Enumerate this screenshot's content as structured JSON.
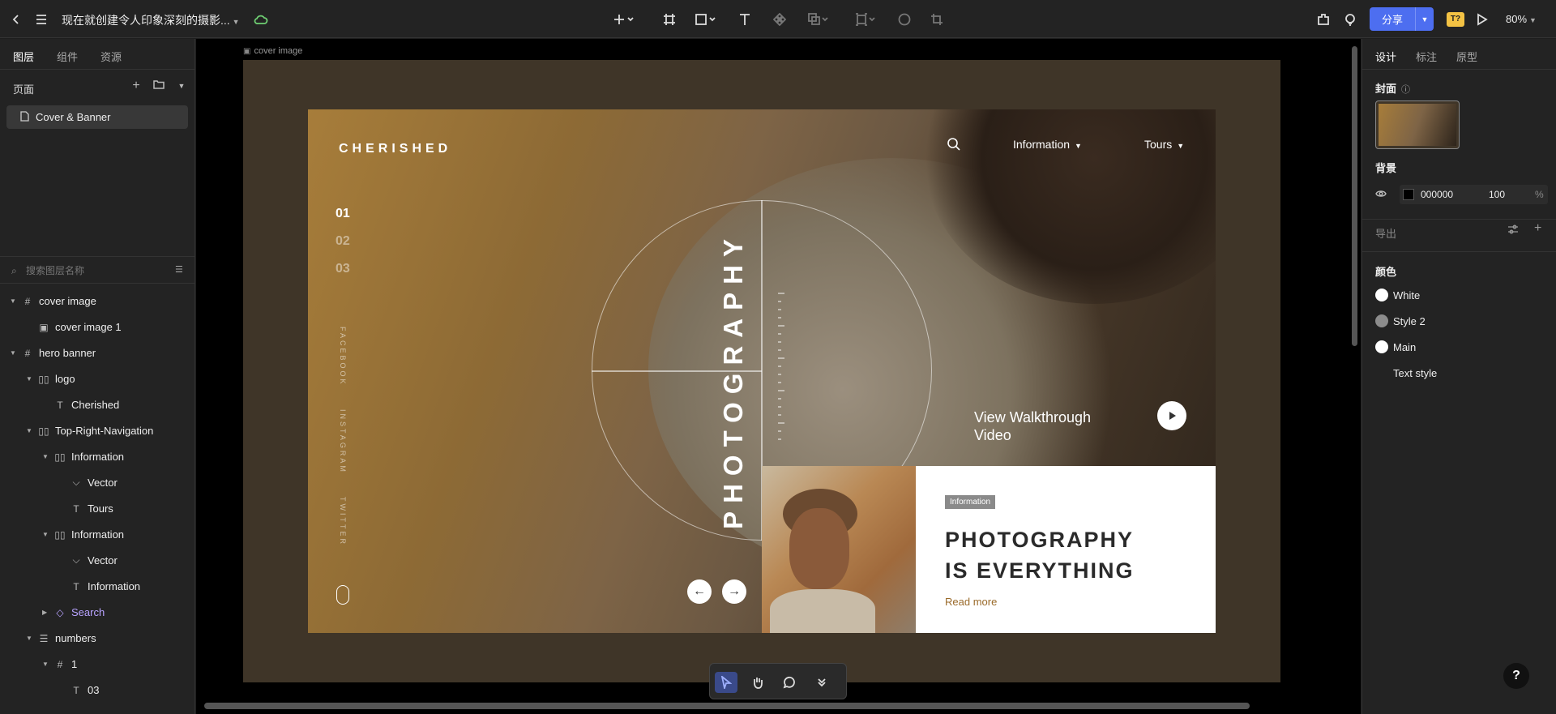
{
  "topbar": {
    "title": "现在就创建令人印象深刻的摄影...",
    "share_label": "分享",
    "zoom": "80%",
    "badge": "T?"
  },
  "left_panel": {
    "tabs": [
      "图层",
      "组件",
      "资源"
    ],
    "pages_label": "页面",
    "current_page": "Cover & Banner",
    "search_placeholder": "搜索图层名称",
    "layers": [
      {
        "name": "cover image",
        "type": "frame",
        "depth": 0,
        "expanded": true
      },
      {
        "name": "cover image 1",
        "type": "image",
        "depth": 1
      },
      {
        "name": "hero banner",
        "type": "frame",
        "depth": 0,
        "expanded": true
      },
      {
        "name": "logo",
        "type": "group",
        "depth": 1,
        "expanded": true
      },
      {
        "name": "Cherished",
        "type": "text",
        "depth": 2
      },
      {
        "name": "Top-Right-Navigation",
        "type": "group",
        "depth": 1,
        "expanded": true
      },
      {
        "name": "Information",
        "type": "group",
        "depth": 2,
        "expanded": true
      },
      {
        "name": "Vector",
        "type": "vector",
        "depth": 3
      },
      {
        "name": "Tours",
        "type": "text",
        "depth": 3
      },
      {
        "name": "Information",
        "type": "group",
        "depth": 2,
        "expanded": true
      },
      {
        "name": "Vector",
        "type": "vector",
        "depth": 3
      },
      {
        "name": "Information",
        "type": "text",
        "depth": 3
      },
      {
        "name": "Search",
        "type": "component",
        "depth": 2,
        "expanded": false
      },
      {
        "name": "numbers",
        "type": "stack",
        "depth": 1,
        "expanded": true
      },
      {
        "name": "1",
        "type": "frame",
        "depth": 2,
        "expanded": true
      },
      {
        "name": "03",
        "type": "text",
        "depth": 3
      }
    ]
  },
  "canvas": {
    "frame_label": "cover image",
    "banner": {
      "logo": "CHERISHED",
      "numbers": [
        "01",
        "02",
        "03"
      ],
      "social": [
        "FACEBOOK",
        "INSTAGRAM",
        "TWITTER"
      ],
      "big_word": "PHOTOGRAPHY",
      "nav": [
        "Information",
        "Tours"
      ],
      "walkthrough": "View Walkthrough Video",
      "card": {
        "tag": "Information",
        "title_line1": "PHOTOGRAPHY",
        "title_line2": "IS EVERYTHING",
        "link": "Read more"
      }
    }
  },
  "right_panel": {
    "tabs": [
      "设计",
      "标注",
      "原型"
    ],
    "cover_label": "封面",
    "background_label": "背景",
    "bg_hex": "000000",
    "bg_opacity": "100",
    "percent": "%",
    "export_label": "导出",
    "colors_label": "颜色",
    "colors": [
      {
        "name": "White",
        "hex": "#ffffff"
      },
      {
        "name": "Style 2",
        "hex": "#8c8c8c"
      },
      {
        "name": "Main",
        "hex": "#ffffff"
      }
    ],
    "text_style_label": "Text style"
  },
  "help_label": "?"
}
